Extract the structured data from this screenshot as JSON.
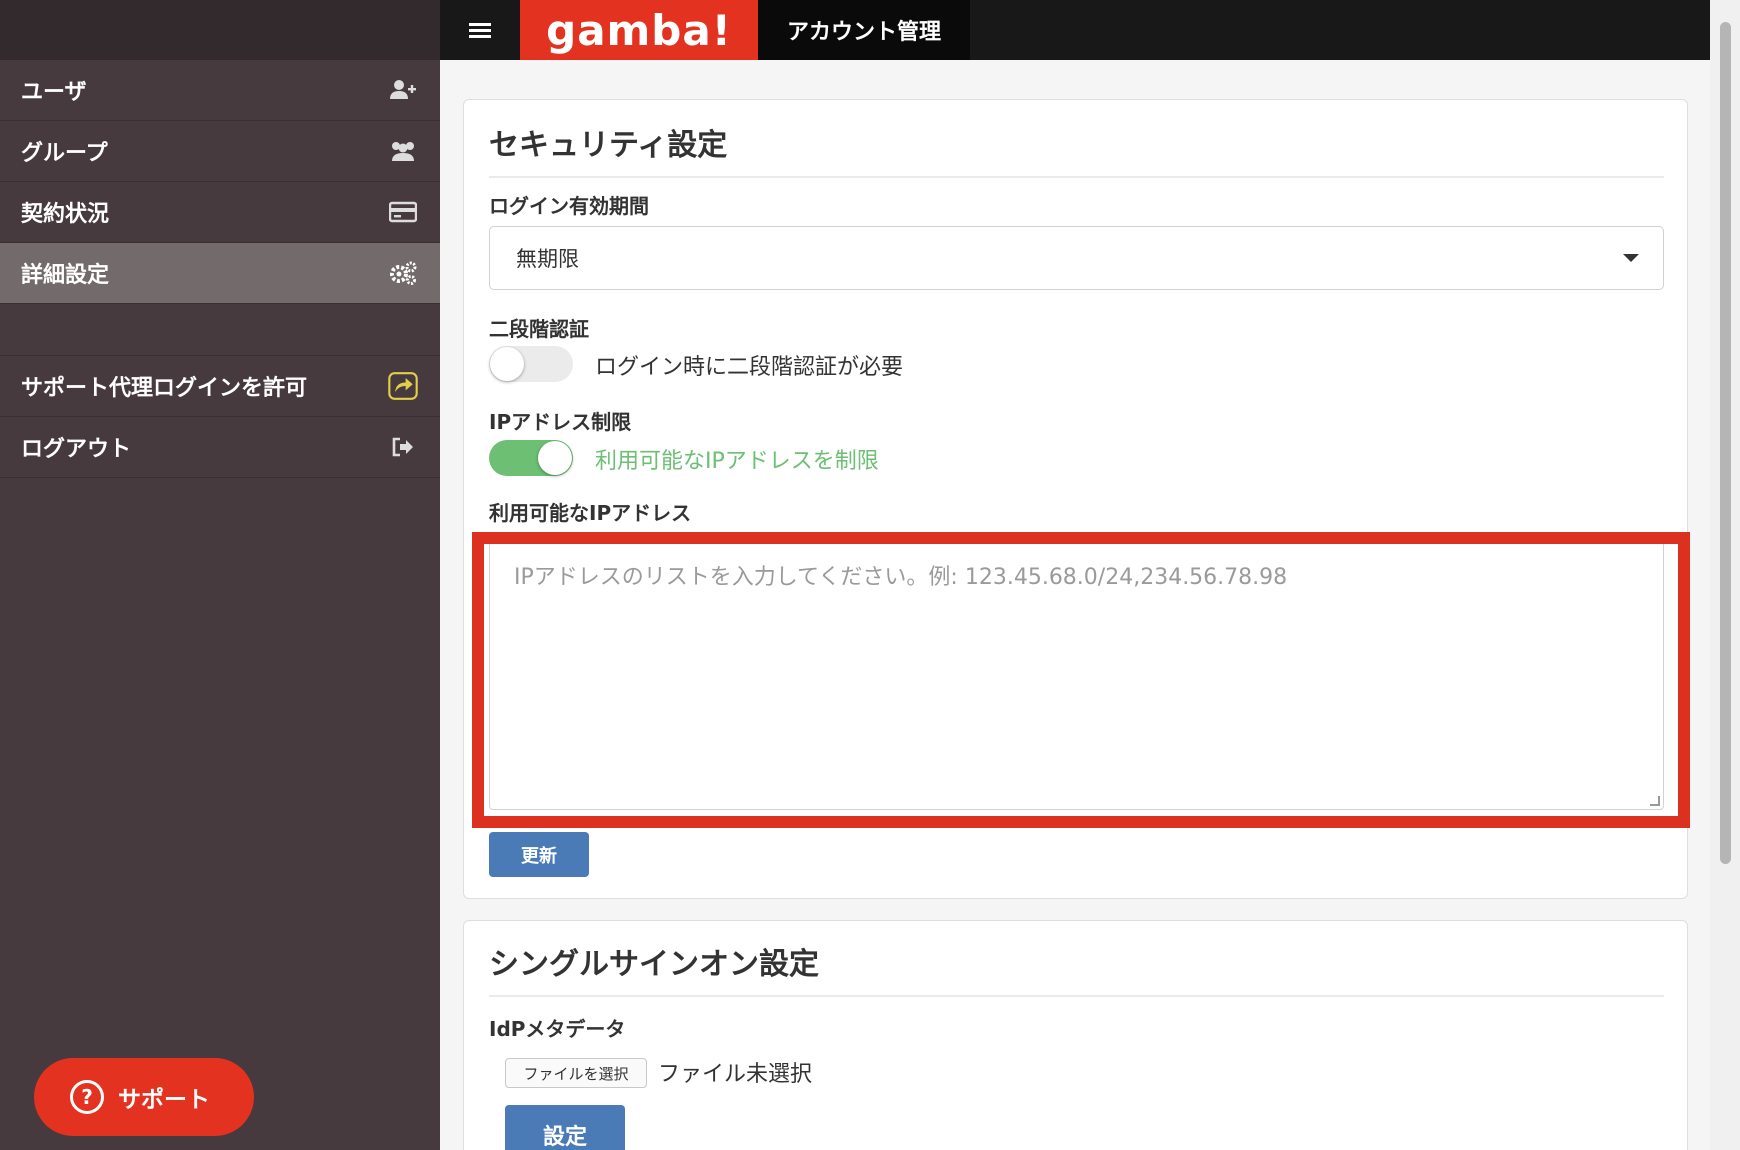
{
  "sidebar": {
    "items": [
      {
        "label": "ユーザ",
        "icon": "add-user-icon"
      },
      {
        "label": "グループ",
        "icon": "group-icon"
      },
      {
        "label": "契約状況",
        "icon": "credit-card-icon"
      },
      {
        "label": "詳細設定",
        "icon": "gears-icon",
        "active": true
      }
    ],
    "actions": [
      {
        "label": "サポート代理ログインを許可",
        "icon": "share-icon"
      },
      {
        "label": "ログアウト",
        "icon": "logout-icon"
      }
    ],
    "support_label": "サポート"
  },
  "header": {
    "logo": "gamba!",
    "title": "アカウント管理"
  },
  "security": {
    "title": "セキュリティ設定",
    "login_expiry_label": "ログイン有効期間",
    "login_expiry_value": "無期限",
    "two_factor_label": "二段階認証",
    "two_factor_text": "ログイン時に二段階認証が必要",
    "two_factor_enabled": false,
    "ip_restrict_label": "IPアドレス制限",
    "ip_restrict_text": "利用可能なIPアドレスを制限",
    "ip_restrict_enabled": true,
    "ip_list_label": "利用可能なIPアドレス",
    "ip_list_placeholder": "IPアドレスのリストを入力してください。例: 123.45.68.0/24,234.56.78.98",
    "update_label": "更新"
  },
  "sso": {
    "title": "シングルサインオン設定",
    "idp_label": "IdPメタデータ",
    "file_button": "ファイルを選択",
    "file_status": "ファイル未選択",
    "set_label": "設定"
  },
  "colors": {
    "brand": "#e3321f",
    "sidebar_bg": "#463a3e",
    "sidebar_active": "#736a6c",
    "toggle_on": "#6cbf73",
    "primary_button": "#4a7bb7",
    "highlight": "#dc3121"
  }
}
